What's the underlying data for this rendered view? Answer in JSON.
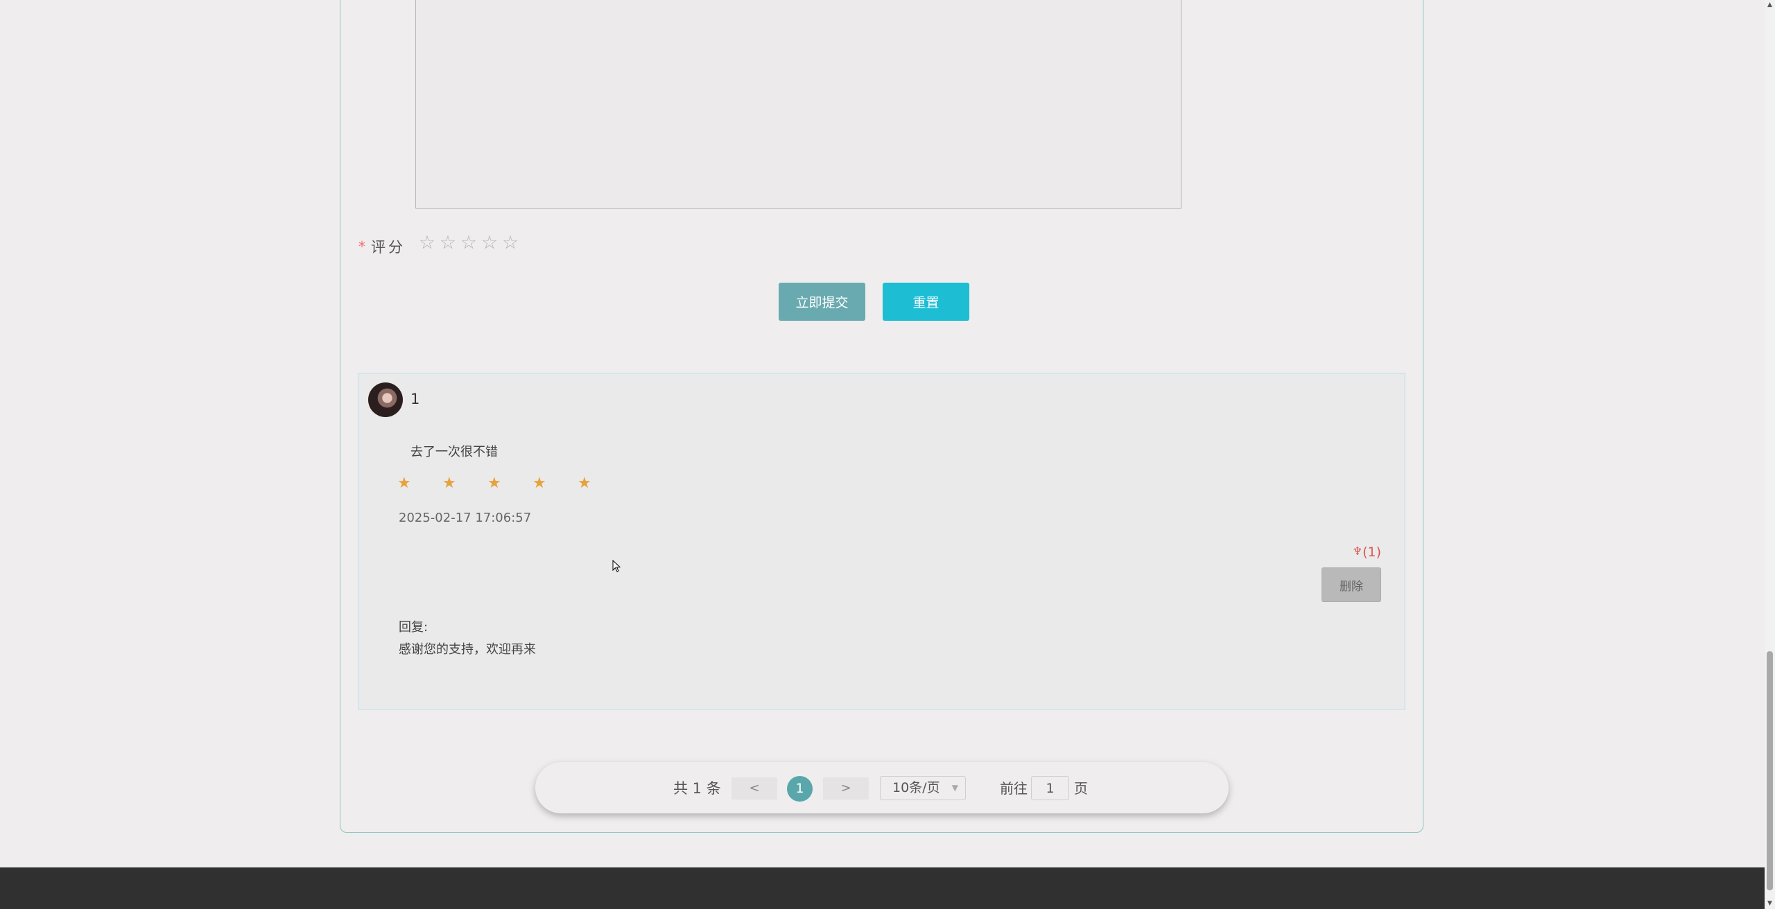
{
  "form": {
    "rating_required_mark": "*",
    "rating_label": "评分",
    "rating_stars": [
      "☆",
      "☆",
      "☆",
      "☆",
      "☆"
    ],
    "rating_value": 0,
    "submit_label": "立即提交",
    "reset_label": "重置"
  },
  "comment": {
    "username": "1",
    "content": "去了一次很不错",
    "stars": [
      "★",
      "★",
      "★",
      "★",
      "★"
    ],
    "rating": 5,
    "time": "2025-02-17 17:06:57",
    "like_icon": "♆",
    "like_count": "(1)",
    "delete_label": "删除",
    "reply_label": "回复:",
    "reply_text": "感谢您的支持，欢迎再来"
  },
  "pagination": {
    "total": "共 1 条",
    "prev": "<",
    "current": "1",
    "next": ">",
    "page_size": "10条/页",
    "goto_label": "前往",
    "goto_value": "1",
    "page_unit": "页"
  },
  "colors": {
    "accent_teal": "#69aab0",
    "accent_cyan": "#1dbdd4",
    "star_gold": "#e6a23c",
    "like_red": "#d9534f"
  },
  "icons": {
    "like": "flower-like-icon",
    "dropdown": "chevron-down-icon",
    "cursor": "mouse-pointer-icon"
  }
}
